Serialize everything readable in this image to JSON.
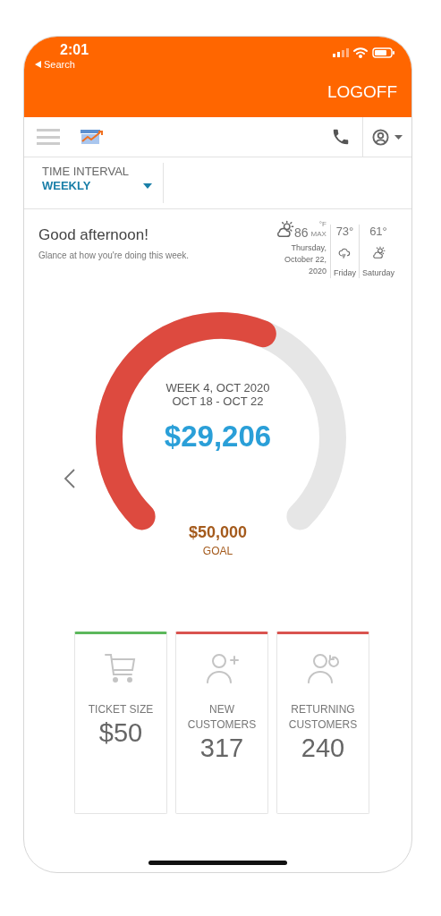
{
  "status_bar": {
    "time": "2:01",
    "back": "Search"
  },
  "header": {
    "logoff": "LOGOFF"
  },
  "time_interval": {
    "label": "TIME INTERVAL",
    "value": "WEEKLY"
  },
  "greeting": {
    "title": "Good afternoon!",
    "subtitle": "Glance at how you're doing this week."
  },
  "weather": {
    "today": {
      "kind": "partly_sunny",
      "temp": "86",
      "unit": "°F",
      "max": "MAX",
      "date": "Thursday, October 22, 2020"
    },
    "forecast": [
      {
        "kind": "rain",
        "temp": "73°",
        "day": "Friday"
      },
      {
        "kind": "partly_sunny",
        "temp": "61°",
        "day": "Saturday"
      }
    ]
  },
  "gauge": {
    "period": "WEEK 4, OCT 2020",
    "range": "OCT 18 - OCT 22",
    "amount": "$29,206",
    "goal": "$50,000",
    "goal_label": "GOAL"
  },
  "cards": [
    {
      "kind": "cart",
      "label": "TICKET SIZE",
      "value": "$50",
      "color": "#5cb85c"
    },
    {
      "kind": "new_customer",
      "label": "NEW CUSTOMERS",
      "value": "317",
      "color": "#d9534f"
    },
    {
      "kind": "returning_customer",
      "label": "RETURNING CUSTOMERS",
      "value": "240",
      "color": "#d9534f"
    }
  ]
}
